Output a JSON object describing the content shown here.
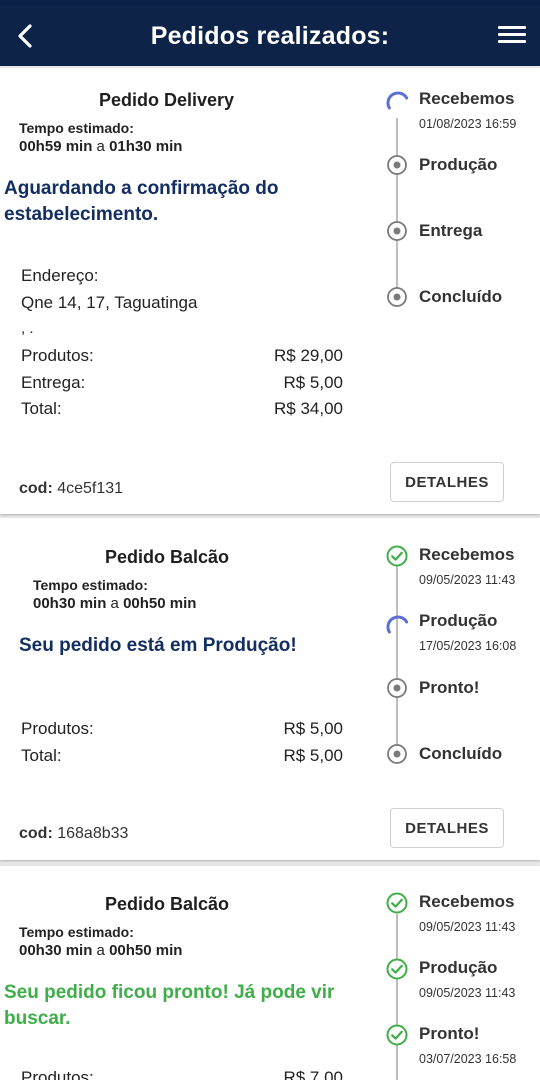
{
  "header": {
    "title": "Pedidos realizados:"
  },
  "orders": [
    {
      "title": "Pedido Delivery",
      "est_label": "Tempo estimado:",
      "est_from": "00h59 min",
      "est_sep": "a",
      "est_to": "01h30 min",
      "status": "Aguardando a confirmação do estabelecimento.",
      "address_label": "Endereço:",
      "address": "Qne 14, 17, Taguatinga",
      "address_extra": ", .",
      "produtos_label": "Produtos:",
      "produtos": "R$ 29,00",
      "entrega_label": "Entrega:",
      "entrega": "R$ 5,00",
      "total_label": "Total:",
      "total": "R$ 34,00",
      "cod_label": "cod:",
      "cod": "4ce5f131",
      "details": "DETALHES",
      "timeline": [
        {
          "label": "Recebemos",
          "date": "01/08/2023 16:59",
          "state": "progress"
        },
        {
          "label": "Produção",
          "date": "",
          "state": "pending"
        },
        {
          "label": "Entrega",
          "date": "",
          "state": "pending"
        },
        {
          "label": "Concluído",
          "date": "",
          "state": "pending"
        }
      ]
    },
    {
      "title": "Pedido Balcão",
      "est_label": "Tempo estimado:",
      "est_from": "00h30 min",
      "est_sep": "a",
      "est_to": "00h50 min",
      "status": "Seu pedido está em Produção!",
      "produtos_label": "Produtos:",
      "produtos": "R$ 5,00",
      "total_label": "Total:",
      "total": "R$ 5,00",
      "cod_label": "cod:",
      "cod": "168a8b33",
      "details": "DETALHES",
      "timeline": [
        {
          "label": "Recebemos",
          "date": "09/05/2023 11:43",
          "state": "done"
        },
        {
          "label": "Produção",
          "date": "17/05/2023 16:08",
          "state": "progress"
        },
        {
          "label": "Pronto!",
          "date": "",
          "state": "pending"
        },
        {
          "label": "Concluído",
          "date": "",
          "state": "pending"
        }
      ]
    },
    {
      "title": "Pedido Balcão",
      "est_label": "Tempo estimado:",
      "est_from": "00h30 min",
      "est_sep": "a",
      "est_to": "00h50 min",
      "status": "Seu pedido ficou pronto! Já pode vir buscar.",
      "produtos_label": "Produtos:",
      "produtos": "R$ 7,00",
      "timeline": [
        {
          "label": "Recebemos",
          "date": "09/05/2023 11:43",
          "state": "done"
        },
        {
          "label": "Produção",
          "date": "09/05/2023 11:43",
          "state": "done"
        },
        {
          "label": "Pronto!",
          "date": "03/07/2023 16:58",
          "state": "done"
        }
      ]
    }
  ],
  "colors": {
    "header": "#0d2448",
    "status_blue": "#132e62",
    "status_green": "#3fae49",
    "progress": "#5a6fd6",
    "done": "#3fae49",
    "pending": "#7a7a7a"
  }
}
